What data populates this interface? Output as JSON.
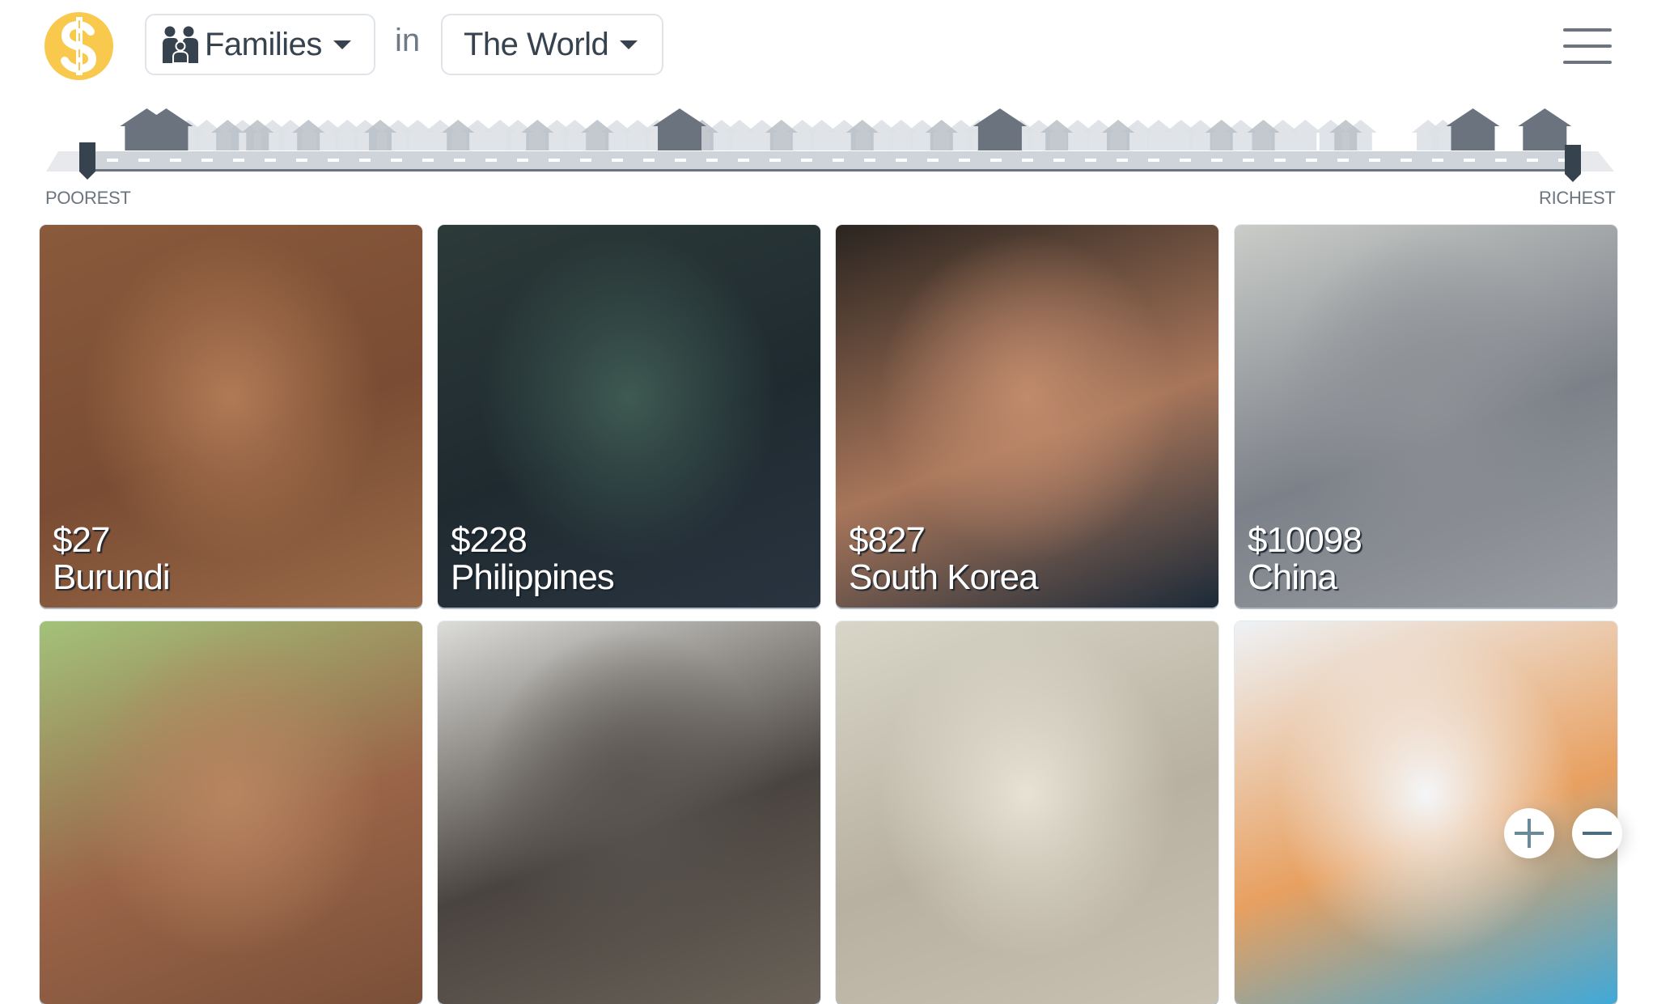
{
  "header": {
    "logo_icon": "dollar-street-logo-icon",
    "things_dropdown": {
      "icon": "family-icon",
      "label": "Families"
    },
    "connector": "in",
    "place_dropdown": {
      "label": "The World"
    },
    "menu_icon": "hamburger-menu-icon"
  },
  "street": {
    "left_label": "POOREST",
    "right_label": "RICHEST",
    "range_selection": {
      "low": 0.0,
      "high": 1.0
    },
    "houses": [
      {
        "pos": 0.044,
        "level": 3
      },
      {
        "pos": 0.057,
        "level": 3
      },
      {
        "pos": 0.072,
        "level": 1
      },
      {
        "pos": 0.084,
        "level": 1
      },
      {
        "pos": 0.098,
        "level": 2
      },
      {
        "pos": 0.108,
        "level": 1
      },
      {
        "pos": 0.118,
        "level": 2
      },
      {
        "pos": 0.128,
        "level": 1
      },
      {
        "pos": 0.14,
        "level": 1
      },
      {
        "pos": 0.152,
        "level": 2
      },
      {
        "pos": 0.165,
        "level": 1
      },
      {
        "pos": 0.178,
        "level": 1
      },
      {
        "pos": 0.19,
        "level": 1
      },
      {
        "pos": 0.2,
        "level": 2
      },
      {
        "pos": 0.212,
        "level": 1
      },
      {
        "pos": 0.225,
        "level": 1
      },
      {
        "pos": 0.24,
        "level": 1
      },
      {
        "pos": 0.252,
        "level": 2
      },
      {
        "pos": 0.265,
        "level": 1
      },
      {
        "pos": 0.28,
        "level": 1
      },
      {
        "pos": 0.292,
        "level": 1
      },
      {
        "pos": 0.305,
        "level": 2
      },
      {
        "pos": 0.318,
        "level": 1
      },
      {
        "pos": 0.33,
        "level": 1
      },
      {
        "pos": 0.345,
        "level": 2
      },
      {
        "pos": 0.358,
        "level": 1
      },
      {
        "pos": 0.372,
        "level": 1
      },
      {
        "pos": 0.385,
        "level": 1
      },
      {
        "pos": 0.4,
        "level": 3
      },
      {
        "pos": 0.415,
        "level": 2
      },
      {
        "pos": 0.428,
        "level": 1
      },
      {
        "pos": 0.44,
        "level": 1
      },
      {
        "pos": 0.455,
        "level": 1
      },
      {
        "pos": 0.468,
        "level": 2
      },
      {
        "pos": 0.482,
        "level": 1
      },
      {
        "pos": 0.495,
        "level": 1
      },
      {
        "pos": 0.51,
        "level": 1
      },
      {
        "pos": 0.522,
        "level": 2
      },
      {
        "pos": 0.535,
        "level": 1
      },
      {
        "pos": 0.548,
        "level": 1
      },
      {
        "pos": 0.562,
        "level": 1
      },
      {
        "pos": 0.575,
        "level": 2
      },
      {
        "pos": 0.588,
        "level": 1
      },
      {
        "pos": 0.6,
        "level": 1
      },
      {
        "pos": 0.614,
        "level": 3
      },
      {
        "pos": 0.628,
        "level": 1
      },
      {
        "pos": 0.64,
        "level": 1
      },
      {
        "pos": 0.652,
        "level": 2
      },
      {
        "pos": 0.666,
        "level": 1
      },
      {
        "pos": 0.68,
        "level": 1
      },
      {
        "pos": 0.693,
        "level": 2
      },
      {
        "pos": 0.706,
        "level": 1
      },
      {
        "pos": 0.72,
        "level": 1
      },
      {
        "pos": 0.735,
        "level": 1
      },
      {
        "pos": 0.748,
        "level": 1
      },
      {
        "pos": 0.762,
        "level": 2
      },
      {
        "pos": 0.775,
        "level": 1
      },
      {
        "pos": 0.79,
        "level": 2
      },
      {
        "pos": 0.803,
        "level": 1
      },
      {
        "pos": 0.818,
        "level": 1
      },
      {
        "pos": 0.835,
        "level": 1
      },
      {
        "pos": 0.845,
        "level": 2
      },
      {
        "pos": 0.855,
        "level": 1
      },
      {
        "pos": 0.9,
        "level": 1
      },
      {
        "pos": 0.91,
        "level": 1
      },
      {
        "pos": 0.93,
        "level": 3
      },
      {
        "pos": 0.978,
        "level": 3
      }
    ]
  },
  "cards": [
    {
      "income": "$27",
      "country": "Burundi",
      "photo": "family-photo",
      "colors": [
        "#8a5a3c",
        "#b07a55",
        "#7a4c33",
        "#9a6a48"
      ]
    },
    {
      "income": "$228",
      "country": "Philippines",
      "photo": "family-photo",
      "colors": [
        "#2c3a38",
        "#3e5a52",
        "#1f2a30",
        "#2a3440"
      ]
    },
    {
      "income": "$827",
      "country": "South Korea",
      "photo": "portrait-photo",
      "colors": [
        "#2a2420",
        "#c08a6c",
        "#a8765a",
        "#1c2a38"
      ]
    },
    {
      "income": "$10098",
      "country": "China",
      "photo": "family-photo",
      "colors": [
        "#c9ccc8",
        "#8e9196",
        "#7c8088",
        "#9a9da2"
      ]
    },
    {
      "income": "",
      "country": "",
      "photo": "family-photo",
      "colors": [
        "#a3c27a",
        "#b88560",
        "#9a6448",
        "#7a5038"
      ]
    },
    {
      "income": "",
      "country": "",
      "photo": "house-photo",
      "colors": [
        "#dcdcd8",
        "#5a5550",
        "#4a4440",
        "#6a6258"
      ]
    },
    {
      "income": "",
      "country": "",
      "photo": "family-photo",
      "colors": [
        "#d8d6c8",
        "#e6e2d4",
        "#b8b0a0",
        "#c8c0b0"
      ]
    },
    {
      "income": "",
      "country": "",
      "photo": "family-photo",
      "colors": [
        "#eef2f6",
        "#f4f6f8",
        "#e8a060",
        "#40a8d8"
      ]
    }
  ],
  "zoom_controls": {
    "zoom_in": "plus-icon",
    "zoom_out": "minus-icon"
  },
  "colors": {
    "accent": "#f9c94d",
    "text": "#37424f",
    "muted": "#6c757f",
    "road": "#cfd4da",
    "handle": "#37424f"
  }
}
